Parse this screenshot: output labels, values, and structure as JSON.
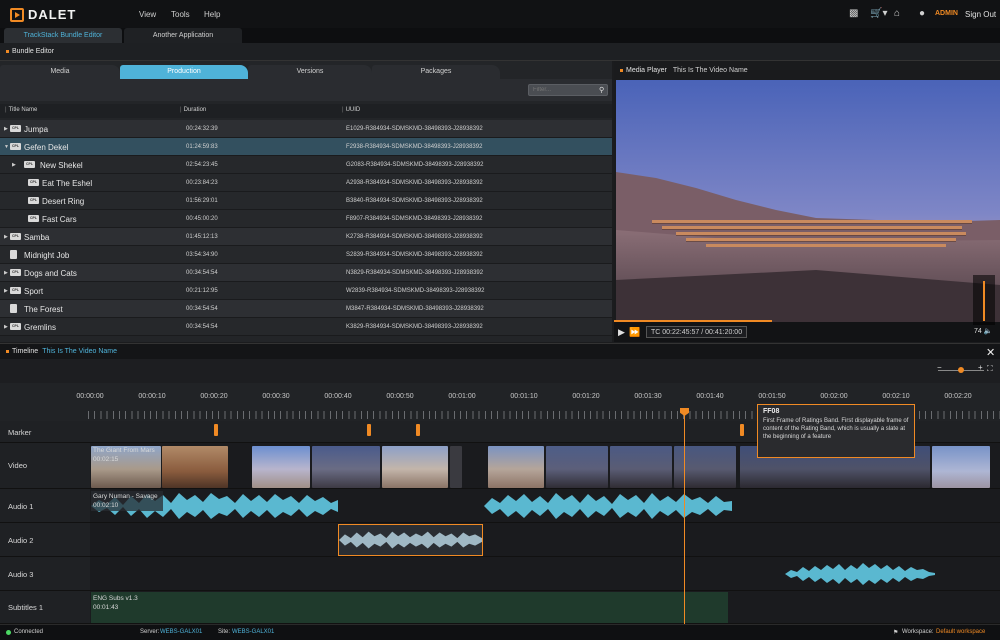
{
  "app": {
    "logo_text": "DALET",
    "menu": [
      "View",
      "Tools",
      "Help"
    ],
    "user": "ADMIN",
    "sign_out": "Sign Out"
  },
  "app_tabs": [
    "TrackStack Bundle Editor",
    "Another Application"
  ],
  "bundle_editor": {
    "title": "Bundle Editor",
    "tabs": [
      "Media",
      "Production",
      "Versions",
      "Packages"
    ],
    "active_tab": "Production",
    "filter_placeholder": "Filter...",
    "columns": [
      "Title Name",
      "Duration",
      "UUID"
    ],
    "rows": [
      {
        "name": "Jumpa",
        "duration": "00:24:32:39",
        "uuid": "E1029-R384934-SDMSKMD-38498393-J28938392"
      },
      {
        "name": "Gefen Dekel",
        "duration": "01:24:59:83",
        "uuid": "F2938-R384934-SDMSKMD-38498393-J28938392"
      },
      {
        "name": "New Shekel",
        "duration": "02:54:23:45",
        "uuid": "G2083-R384934-SDMSKMD-38498393-J28938392"
      },
      {
        "name": "Eat The Eshel",
        "duration": "00:23:84:23",
        "uuid": "A2938-R384934-SDMSKMD-38498393-J28938392"
      },
      {
        "name": "Desert Ring",
        "duration": "01:56:29:01",
        "uuid": "B3840-R384934-SDMSKMD-38498393-J28938392"
      },
      {
        "name": "Fast Cars",
        "duration": "00:45:00:20",
        "uuid": "F8907-R384934-SDMSKMD-38498393-J28938392"
      },
      {
        "name": "Samba",
        "duration": "01:45:12:13",
        "uuid": "K2738-R384934-SDMSKMD-38498393-J28938392"
      },
      {
        "name": "Midnight Job",
        "duration": "03:54:34:90",
        "uuid": "S2839-R384934-SDMSKMD-38498393-J28938392"
      },
      {
        "name": "Dogs and Cats",
        "duration": "00:34:54:54",
        "uuid": "N3829-R384934-SDMSKMD-38498393-J28938392"
      },
      {
        "name": "Sport",
        "duration": "00:21:12:95",
        "uuid": "W2839-R384934-SDMSKMD-38498393-J28938392"
      },
      {
        "name": "The Forest",
        "duration": "00:34:54:54",
        "uuid": "M3847-R384934-SDMSKMD-38498393-J28938392"
      },
      {
        "name": "Gremlins",
        "duration": "00:34:54:54",
        "uuid": "K3829-R384934-SDMSKMD-38498393-J28938392"
      }
    ]
  },
  "media_player": {
    "title": "Media Player",
    "subtitle": "This Is The Video Name",
    "timecode": "TC 00:22:45:57",
    "duration": "00:41:20:00",
    "volume": "74",
    "progress": 0.41
  },
  "timeline": {
    "title": "Timeline",
    "subtitle": "This Is The Video Name",
    "ticks": [
      "00:00:00",
      "00:00:10",
      "00:00:20",
      "00:00:30",
      "00:00:40",
      "00:00:50",
      "00:01:00",
      "00:01:10",
      "00:01:20",
      "00:01:30",
      "00:01:40",
      "00:01:50",
      "00:02:00",
      "00:02:10",
      "00:02:20"
    ],
    "tracks": [
      "Marker",
      "Video",
      "Audio 1",
      "Audio 2",
      "Audio 3",
      "Subtitles 1"
    ],
    "video_clip": {
      "name": "The Giant From Mars",
      "tc": "00:02:15"
    },
    "audio1_clip": {
      "name": "Gary Numan - Savage",
      "tc": "00:02:10"
    },
    "subtitle_clip": {
      "name": "ENG Subs v1.3",
      "tc": "00:01:43"
    },
    "tooltip": {
      "title": "FF08",
      "body": "First Frame of Ratings Band. First displayable frame of content of the Rating Band, which is usually a slate at the beginning of a feature"
    }
  },
  "status": {
    "connected": "Connected",
    "server_label": "Server:",
    "server": "WEBS-GALX01",
    "site_label": "Site:",
    "site": "WEBS-GALX01",
    "workspace_label": "Workspace:",
    "workspace": "Default workspace"
  },
  "colors": {
    "accent": "#f08a24",
    "blue": "#4fb3d9",
    "wave": "#5ab8d0"
  }
}
